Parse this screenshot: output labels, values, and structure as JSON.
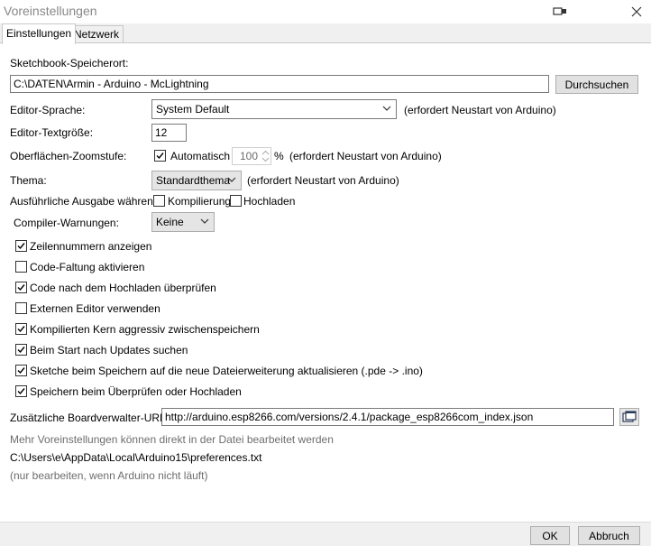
{
  "window": {
    "title": "Voreinstellungen"
  },
  "tabs": [
    {
      "label": "Einstellungen"
    },
    {
      "label": "Netzwerk"
    }
  ],
  "sketchbook": {
    "label": "Sketchbook-Speicherort:",
    "path": "C:\\DATEN\\Armin - Arduino - McLightning",
    "browse_label": "Durchsuchen"
  },
  "editor_language": {
    "label": "Editor-Sprache:",
    "value": "System Default",
    "note": "(erfordert Neustart von Arduino)"
  },
  "editor_textsize": {
    "label": "Editor-Textgröße:",
    "value": "12"
  },
  "zoom": {
    "label": "Oberflächen-Zoomstufe:",
    "auto_label": "Automatisch",
    "auto_checked": true,
    "value": "100",
    "unit": "%",
    "note": "(erfordert Neustart von Arduino)"
  },
  "theme": {
    "label": "Thema:",
    "value": "Standardthema",
    "note": "(erfordert Neustart von Arduino)"
  },
  "verbose": {
    "label": "Ausführliche Ausgabe während:",
    "compile_label": "Kompilierung",
    "compile_checked": false,
    "upload_label": "Hochladen",
    "upload_checked": false
  },
  "compiler_warnings": {
    "label": "Compiler-Warnungen:",
    "value": "Keine"
  },
  "options": [
    {
      "label": "Zeilennummern anzeigen",
      "checked": true
    },
    {
      "label": "Code-Faltung aktivieren",
      "checked": false
    },
    {
      "label": "Code nach dem Hochladen überprüfen",
      "checked": true
    },
    {
      "label": "Externen Editor verwenden",
      "checked": false
    },
    {
      "label": "Kompilierten Kern aggressiv zwischenspeichern",
      "checked": true
    },
    {
      "label": "Beim Start nach Updates suchen",
      "checked": true
    },
    {
      "label": "Sketche beim Speichern auf die neue Dateierweiterung aktualisieren (.pde -> .ino)",
      "checked": true
    },
    {
      "label": "Speichern beim Überprüfen oder Hochladen",
      "checked": true
    }
  ],
  "board_urls": {
    "label": "Zusätzliche Boardverwalter-URLs:",
    "value": "http://arduino.esp8266.com/versions/2.4.1/package_esp8266com_index.json"
  },
  "info": {
    "line1": "Mehr Voreinstellungen können direkt in der Datei bearbeitet werden",
    "line2": "C:\\Users\\e\\AppData\\Local\\Arduino15\\preferences.txt",
    "line3": "(nur bearbeiten, wenn Arduino nicht läuft)"
  },
  "footer": {
    "ok_label": "OK",
    "cancel_label": "Abbruch"
  }
}
